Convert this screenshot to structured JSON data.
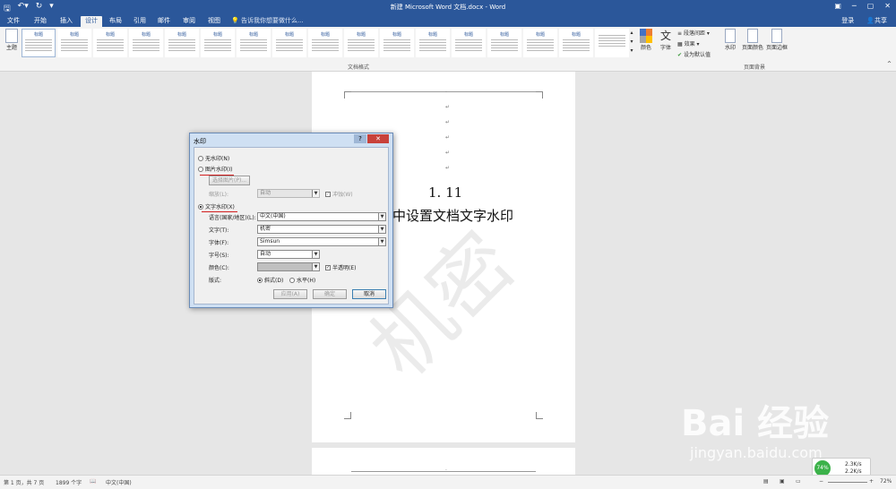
{
  "window": {
    "title": "新建 Microsoft Word 文档.docx - Word"
  },
  "tabs": [
    {
      "label": "文件"
    },
    {
      "label": "开始"
    },
    {
      "label": "插入"
    },
    {
      "label": "设计"
    },
    {
      "label": "布局"
    },
    {
      "label": "引用"
    },
    {
      "label": "邮件"
    },
    {
      "label": "审阅"
    },
    {
      "label": "视图"
    }
  ],
  "tell_me": "告诉我你想要做什么...",
  "account": {
    "login": "登录",
    "share": "共享"
  },
  "ribbon": {
    "theme_label": "主题",
    "gallery_titles": [
      "标题",
      "标题",
      "标题",
      "标题",
      "标题",
      "标题",
      "标题",
      "标题",
      "标题",
      "标题",
      "标题",
      "标题",
      "标题",
      "标题",
      "标题",
      "标题"
    ],
    "group_label": "文档格式",
    "colors_label": "颜色",
    "fonts_label": "字体",
    "paragraph_spacing": "段落间距",
    "effects": "效果",
    "set_default": "设为默认值",
    "watermark": "水印",
    "page_color": "页面颜色",
    "page_borders": "页面边框",
    "page_background_label": "页面背景"
  },
  "document": {
    "heading_number": "1. 11",
    "heading_text": "中设置文档文字水印",
    "watermark_text": "机密"
  },
  "dialog": {
    "title": "水印",
    "help": "?",
    "close": "✕",
    "no_watermark": "无水印(N)",
    "picture_watermark": "图片水印(I)",
    "select_picture": "选择图片(P)...",
    "scale_label": "缩放(L):",
    "scale_value": "自动",
    "washout": "冲蚀(W)",
    "text_watermark": "文字水印(X)",
    "language_label": "语言(国家/地区)(L):",
    "language_value": "中文(中国)",
    "text_label": "文字(T):",
    "text_value": "机密",
    "font_label": "字体(F):",
    "font_value": "Simsun",
    "size_label": "字号(S):",
    "size_value": "自动",
    "color_label": "颜色(C):",
    "semitransparent": "半透明(E)",
    "layout_label": "版式:",
    "diagonal": "斜式(D)",
    "horizontal": "水平(H)",
    "apply": "应用(A)",
    "ok": "确定",
    "cancel": "取消"
  },
  "status": {
    "page": "第 1 页，共 7 页",
    "words": "1899 个字",
    "language": "中文(中国)",
    "zoom": "72%"
  },
  "speed_widget": {
    "percent": "74%",
    "up": "2.3K/s",
    "down": "2.2K/s"
  },
  "watermark_overlay": {
    "brand": "Bai 经验",
    "url": "jingyan.baidu.com"
  }
}
